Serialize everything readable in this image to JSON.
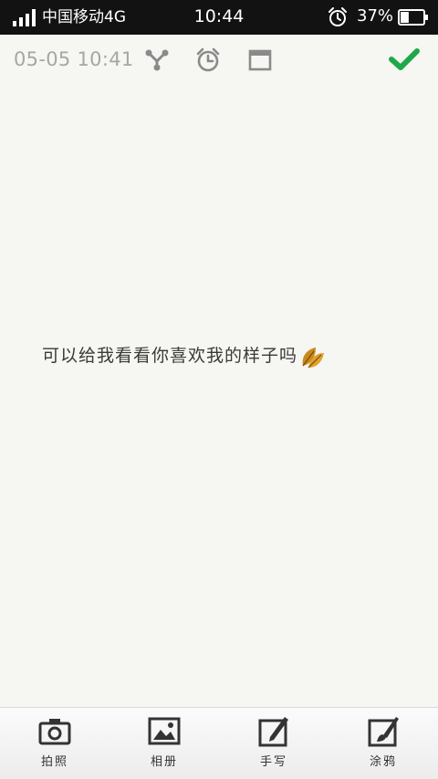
{
  "status_bar": {
    "carrier": "中国移动4G",
    "time": "10:44",
    "battery_percent": "37%",
    "battery_level": 0.37
  },
  "toolbar": {
    "date": "05-05 10:41",
    "icons": [
      "share-icon",
      "alarm-clock-icon",
      "window-icon",
      "checkmark-icon"
    ],
    "accent_color": "#1fa84a"
  },
  "note": {
    "text": "可以给我看看你喜欢我的样子吗",
    "emoji": "leaf-icon"
  },
  "bottom_bar": {
    "items": [
      {
        "label": "拍照",
        "icon": "camera-icon"
      },
      {
        "label": "相册",
        "icon": "photo-album-icon"
      },
      {
        "label": "手写",
        "icon": "handwriting-pen-icon"
      },
      {
        "label": "涂鸦",
        "icon": "paintbrush-icon"
      }
    ]
  }
}
